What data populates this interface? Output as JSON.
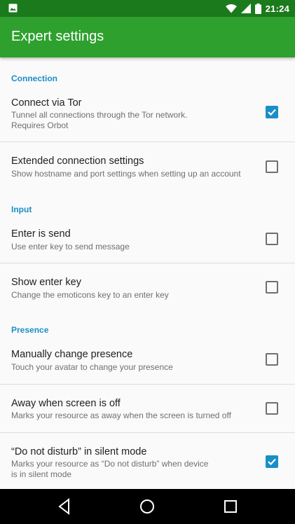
{
  "status_bar": {
    "time": "21:24",
    "icons": [
      "image-notification-icon",
      "wifi-icon",
      "cell-signal-icon",
      "battery-icon"
    ]
  },
  "app_bar": {
    "title": "Expert settings"
  },
  "sections": {
    "connection": "Connection",
    "input": "Input",
    "presence": "Presence"
  },
  "prefs": {
    "connect_via_tor": {
      "title": "Connect via Tor",
      "summary_line1": "Tunnel all connections through the Tor network.",
      "summary_line2": "Requires Orbot",
      "checked": true
    },
    "extended_connection": {
      "title": "Extended connection settings",
      "summary": "Show hostname and port settings when setting up an account",
      "checked": false
    },
    "enter_is_send": {
      "title": "Enter is send",
      "summary": "Use enter key to send message",
      "checked": false
    },
    "show_enter_key": {
      "title": "Show enter key",
      "summary": "Change the emoticons key to an enter key",
      "checked": false
    },
    "manually_change_presence": {
      "title": "Manually change presence",
      "summary": "Touch your avatar to change your presence",
      "checked": false
    },
    "away_when_screen_off": {
      "title": "Away when screen is off",
      "summary": "Marks your resource as away when the screen is turned off",
      "checked": false
    },
    "dnd_in_silent_mode": {
      "title": "“Do not disturb” in silent mode",
      "summary_line1": "Marks your resource as “Do not disturb” when device",
      "summary_line2": "is in silent mode",
      "checked": true
    }
  },
  "nav_bar": {
    "icons": [
      "back-icon",
      "home-icon",
      "recents-icon"
    ]
  },
  "colors": {
    "status_bar": "#1b7a1b",
    "app_bar": "#2ea02e",
    "accent": "#1a8fc6",
    "background": "#fafafa"
  }
}
